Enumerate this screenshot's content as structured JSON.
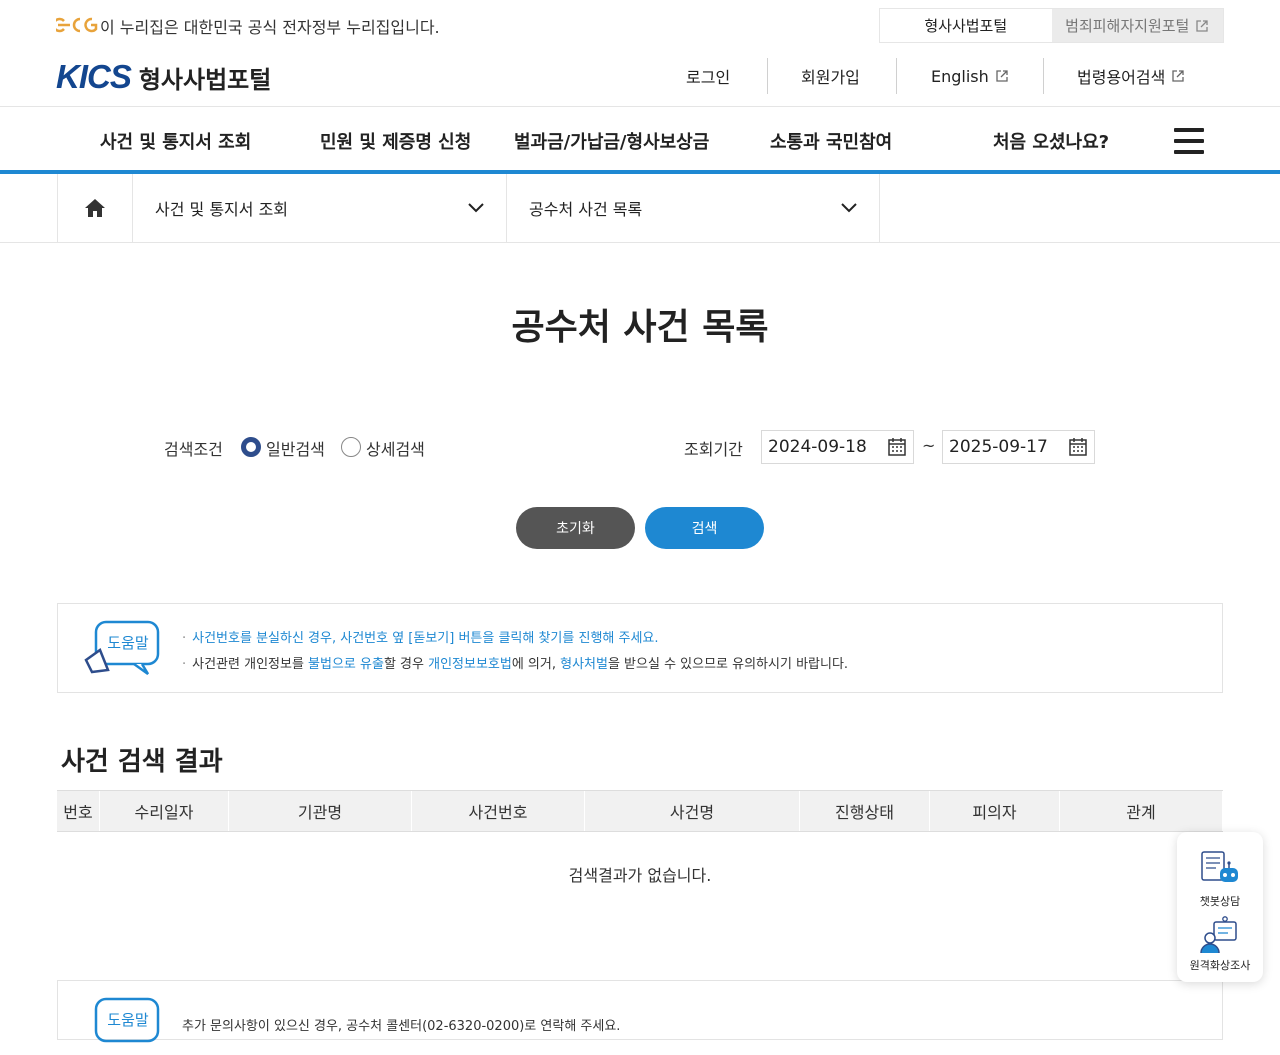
{
  "gov_banner": {
    "text": "이 누리집은 대한민국 공식 전자정부 누리집입니다.",
    "portal_tabs": [
      {
        "label": "형사사법포털"
      },
      {
        "label": "범죄피해자지원포털"
      }
    ]
  },
  "header": {
    "logo_text": "KICS",
    "site_name": "형사사법포털",
    "util_links": {
      "login": "로그인",
      "signup": "회원가입",
      "english": "English",
      "glossary": "법령용어검색"
    }
  },
  "gnb": {
    "items": [
      {
        "label": "사건 및 통지서 조회"
      },
      {
        "label": "민원 및 제증명 신청"
      },
      {
        "label": "벌과금/가납금/형사보상금"
      },
      {
        "label": "소통과 국민참여"
      },
      {
        "label": "처음 오셨나요?"
      }
    ]
  },
  "breadcrumb": {
    "level1": "사건 및 통지서 조회",
    "level2": "공수처 사건 목록"
  },
  "page": {
    "title": "공수처 사건 목록"
  },
  "search": {
    "condition_label": "검색조건",
    "radio_general": "일반검색",
    "radio_detail": "상세검색",
    "selected": "일반검색",
    "period_label": "조회기간",
    "date_from": "2024-09-18",
    "date_to": "2025-09-17",
    "tilde": "~",
    "reset_label": "초기화",
    "search_label": "검색"
  },
  "help": {
    "badge": "도움말",
    "line1": "사건번호를 분실하신 경우, 사건번호 옆 [돋보기] 버튼을 클릭해 찾기를 진행해 주세요.",
    "line2_a": "사건관련 개인정보를 ",
    "line2_b": "불법으로 유출",
    "line2_c": "할 경우 ",
    "line2_d": "개인정보보호법",
    "line2_e": "에 의거, ",
    "line2_f": "형사처벌",
    "line2_g": "을 받으실 수 있으므로 유의하시기 바랍니다.",
    "line3": "추가 문의사항이 있으신 경우, 공수처 콜센터(02-6320-0200)로 연락해 주세요."
  },
  "results": {
    "title": "사건 검색 결과",
    "columns": [
      "번호",
      "수리일자",
      "기관명",
      "사건번호",
      "사건명",
      "진행상태",
      "피의자",
      "관계"
    ],
    "empty_text": "검색결과가 없습니다."
  },
  "floating": {
    "chatbot": "챗봇상담",
    "remote": "원격화상조사"
  },
  "colors": {
    "accent": "#1e88d2",
    "brand": "#13468f",
    "reset_button": "#555555"
  }
}
